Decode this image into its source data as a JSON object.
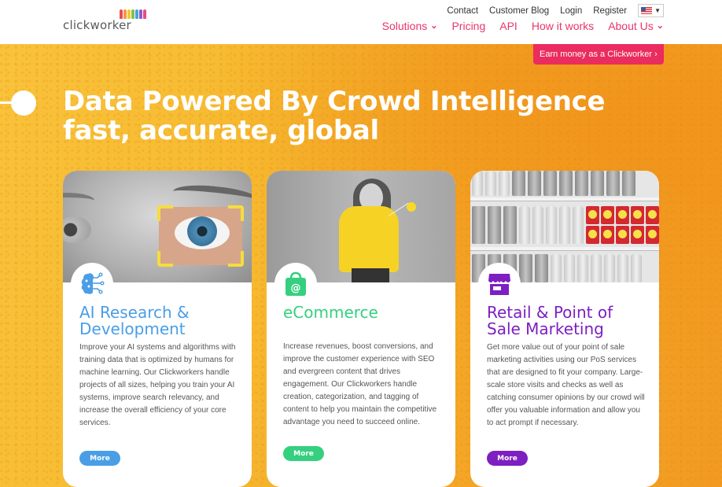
{
  "header": {
    "logo_text": "clickworker",
    "top_links": [
      "Contact",
      "Customer Blog",
      "Login",
      "Register"
    ],
    "language": {
      "icon": "us-flag-icon"
    },
    "main_nav": [
      {
        "label": "Solutions",
        "has_dropdown": true
      },
      {
        "label": "Pricing",
        "has_dropdown": false
      },
      {
        "label": "API",
        "has_dropdown": false
      },
      {
        "label": "How it works",
        "has_dropdown": false
      },
      {
        "label": "About Us",
        "has_dropdown": true
      }
    ]
  },
  "hero": {
    "cta_label": "Earn money as a Clickworker ›",
    "title_line1": "Data Powered By Crowd Intelligence",
    "title_line2": "fast, accurate, global"
  },
  "cards": [
    {
      "icon": "brain-circuit-icon",
      "title_line1": "AI Research &",
      "title_line2": "Development",
      "body": "Improve your AI systems and algorithms with training data that is optimized by humans for machine learning. Our Clickworkers handle projects of all sizes, helping you train your AI systems, improve search relevancy, and increase the overall efficiency of your core services.",
      "button": "More",
      "color": "#4a9ee6"
    },
    {
      "icon": "shopping-bag-at-icon",
      "title_line1": "eCommerce",
      "title_line2": "",
      "body": "Increase revenues, boost conversions, and improve the customer experience with SEO and evergreen content that drives engagement. Our Clickworkers handle creation, categorization, and tagging of content to help you maintain the competitive advantage you need to succeed online.",
      "button": "More",
      "color": "#35d07f"
    },
    {
      "icon": "storefront-icon",
      "title_line1": "Retail & Point of",
      "title_line2": "Sale Marketing",
      "body": "Get more value out of your point of sale marketing activities using our PoS services that are designed to fit your company. Large-scale store visits and checks as well as catching consumer opinions by our crowd will offer you valuable information and allow you to act prompt if necessary.",
      "button": "More",
      "color": "#7d1fc1"
    }
  ],
  "colors": {
    "brand_pink": "#e8356b",
    "cta_red": "#ea2c5f",
    "hero_yellow": "#f6ba30"
  }
}
